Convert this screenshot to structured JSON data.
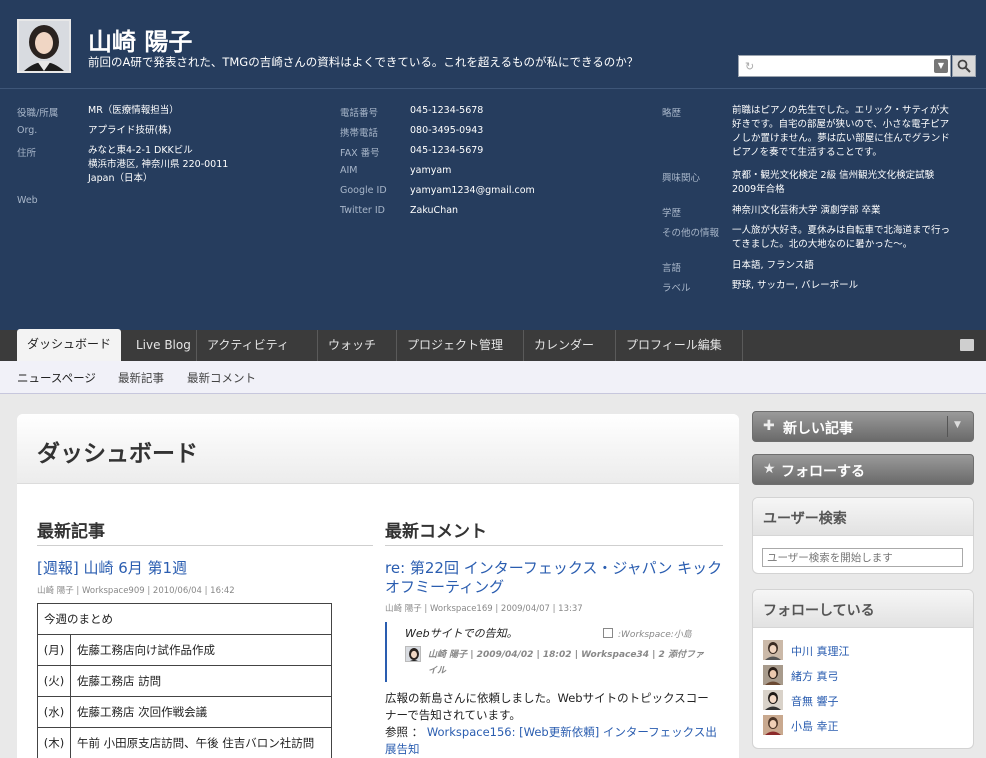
{
  "profile": {
    "name": "山崎 陽子",
    "tagline": "前回のA研で発表された、TMGの吉崎さんの資料はよくできている。これを超えるものが私にできるのか？",
    "col1": [
      {
        "label": "役職/所属",
        "value": "MR（医療情報担当）"
      },
      {
        "label": "Org.",
        "value": "アプライド技研(株)"
      },
      {
        "label": "住所",
        "value": "みなと東4-2-1 DKKビル\n横浜市港区, 神奈川県 220-0011\nJapan（日本）"
      },
      {
        "label": "Web",
        "value": ""
      }
    ],
    "col2": [
      {
        "label": "電話番号",
        "value": "045-1234-5678"
      },
      {
        "label": "携帯電話",
        "value": "080-3495-0943"
      },
      {
        "label": "FAX 番号",
        "value": "045-1234-5679"
      },
      {
        "label": "AIM",
        "value": "yamyam"
      },
      {
        "label": "Google ID",
        "value": "yamyam1234@gmail.com"
      },
      {
        "label": "Twitter ID",
        "value": "ZakuChan"
      }
    ],
    "col3": [
      {
        "label": "略歴",
        "value": "前職はピアノの先生でした。エリック・サティが大\n好きです。自宅の部屋が狭いので、小さな電子ピア\nノしか置けません。夢は広い部屋に住んでグランド\nピアノを奏でて生活することです。"
      },
      {
        "label": "興味関心",
        "value": "京都・観光文化検定 2級 信州観光文化検定試験\n2009年合格"
      },
      {
        "label": "学歴",
        "value": "神奈川文化芸術大学 演劇学部 卒業"
      },
      {
        "label": "その他の情報",
        "value": "一人旅が大好き。夏休みは自転車で北海道まで行っ\nてきました。北の大地なのに暑かった〜。"
      },
      {
        "label": "言語",
        "value": "日本語, フランス語"
      },
      {
        "label": "ラベル",
        "value": "野球, サッカー, バレーボール"
      }
    ]
  },
  "tabs": [
    "ダッシュボード",
    "Live Blog",
    "アクティビティ",
    "ウォッチ",
    "プロジェクト管理",
    "カレンダー",
    "プロフィール編集"
  ],
  "subnav": [
    "ニュースページ",
    "最新記事",
    "最新コメント"
  ],
  "main": {
    "title": "ダッシュボード",
    "latest_posts": {
      "heading": "最新記事",
      "post_title": "[週報] 山崎 6月 第1週",
      "meta": "山崎 陽子 | Workspace909 | 2010/06/04 | 16:42",
      "table_head": "今週のまとめ",
      "rows": [
        {
          "day": "(月)",
          "text": "佐藤工務店向け試作品作成"
        },
        {
          "day": "(火)",
          "text": "佐藤工務店 訪問"
        },
        {
          "day": "(水)",
          "text": "佐藤工務店 次回作戦会議"
        },
        {
          "day": "(木)",
          "text": "午前 小田原支店訪問、午後 住吉バロン社訪問"
        }
      ]
    },
    "latest_comments": {
      "heading": "最新コメント",
      "comment_title": "re: 第22回 インターフェックス・ジャパン キックオフミーティング",
      "meta": "山崎 陽子 | Workspace169 | 2009/04/07 | 13:37",
      "quote_text": "Webサイトでの告知。",
      "quote_workspace": ":Workspace:小島",
      "quote_meta_line1": "山崎 陽子 | 2009/04/02 | 18:02 | Workspace34 | 2 添付ファ",
      "quote_meta_line2": "イル",
      "body_line1": "広報の新島さんに依頼しました。Webサイトのトピックスコー",
      "body_line2": "ナーで告知されています。",
      "ref_label": "参照 ：",
      "ref_link": "Workspace156: [Web更新依頼] インターフェックス出",
      "ref_link2": "展告知"
    }
  },
  "sidebar": {
    "new_post_label": "新しい記事",
    "follow_label": "フォローする",
    "user_search_title": "ユーザー検索",
    "user_search_placeholder": "ユーザー検索を開始します",
    "following_title": "フォローしている",
    "following": [
      "中川 真理江",
      "緒方 真弓",
      "音無 響子",
      "小島 幸正"
    ]
  },
  "colors": {
    "header_bg": "#263d5e",
    "tabbar_bg": "#3b3b3b",
    "link": "#2a5db0"
  }
}
